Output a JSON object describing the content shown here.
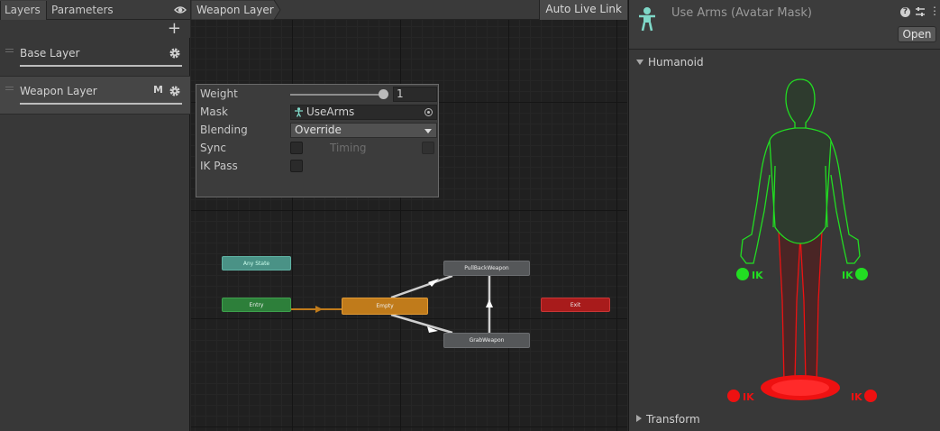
{
  "layers_panel": {
    "tabs": [
      "Layers",
      "Parameters"
    ],
    "add_label": "+",
    "layers": [
      {
        "name": "Base Layer",
        "badge": ""
      },
      {
        "name": "Weapon Layer",
        "badge": "M"
      }
    ]
  },
  "graph": {
    "breadcrumb": "Weapon Layer",
    "auto_live_link": "Auto Live Link",
    "nodes": {
      "any_state": "Any State",
      "entry": "Entry",
      "empty": "Empty",
      "pull_back": "PullBackWeapon",
      "grab": "GrabWeapon",
      "exit": "Exit"
    }
  },
  "layer_settings": {
    "weight_label": "Weight",
    "weight_value": "1",
    "mask_label": "Mask",
    "mask_value": "UseArms",
    "blending_label": "Blending",
    "blending_value": "Override",
    "sync_label": "Sync",
    "timing_label": "Timing",
    "ik_pass_label": "IK Pass",
    "sync_checked": false,
    "timing_checked": false,
    "ik_pass_checked": false
  },
  "inspector": {
    "title": "Use Arms (Avatar Mask)",
    "open_label": "Open",
    "humanoid_label": "Humanoid",
    "transform_label": "Transform",
    "ik_label": "IK",
    "colors": {
      "enabled": "#22dd22",
      "disabled": "#ee1111"
    }
  }
}
